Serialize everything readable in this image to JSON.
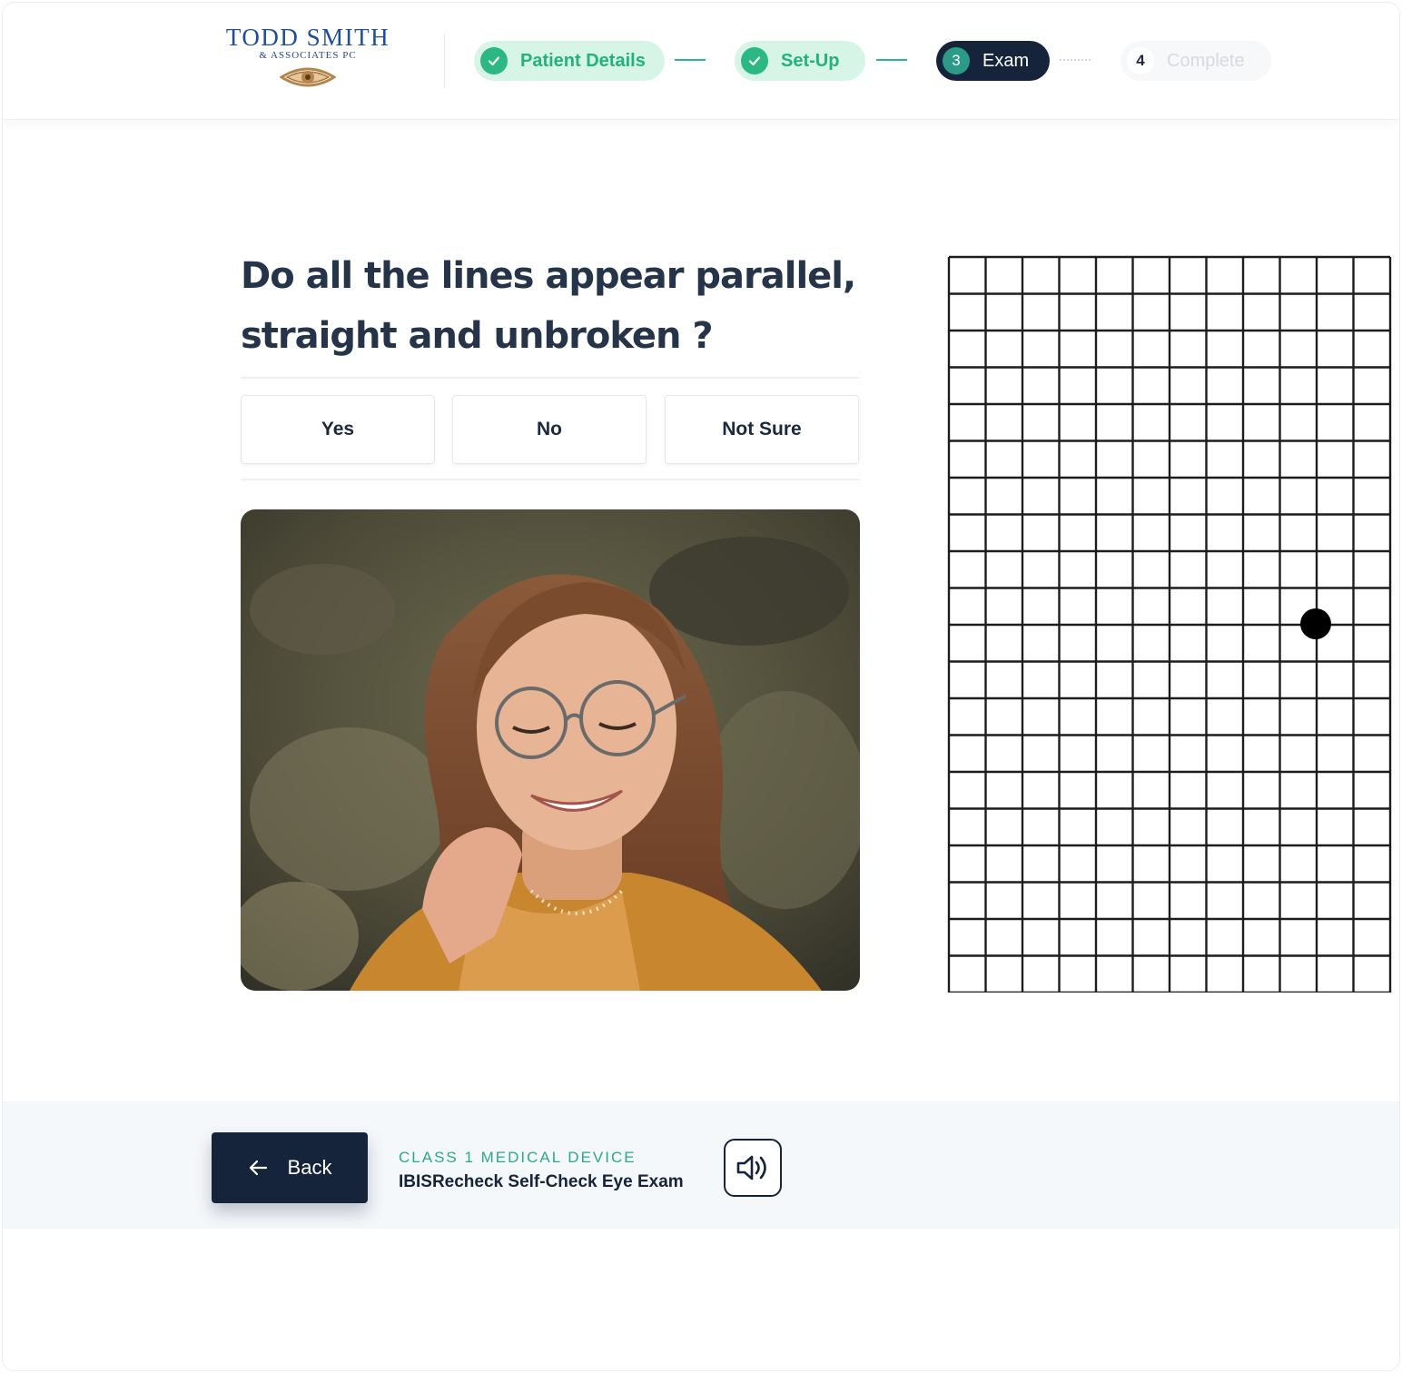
{
  "brand": {
    "name": "TODD SMITH",
    "subtitle": "& ASSOCIATES PC",
    "eye_color": "#b78449"
  },
  "stepper": [
    {
      "number": "",
      "label": "Patient Details",
      "state": "done"
    },
    {
      "number": "",
      "label": "Set-Up",
      "state": "done"
    },
    {
      "number": "3",
      "label": "Exam",
      "state": "active"
    },
    {
      "number": "4",
      "label": "Complete",
      "state": "todo"
    }
  ],
  "question": {
    "line1": "Do all the lines appear parallel,",
    "line2": "straight and unbroken ?"
  },
  "answers": {
    "yes": "Yes",
    "no": "No",
    "not_sure": "Not Sure"
  },
  "photo": {
    "icon": "person-with-glasses-photo"
  },
  "amsler_grid": {
    "columns": 12,
    "rows": 20,
    "line_color": "#1d1d1d"
  },
  "footer": {
    "back_label": "Back",
    "device_class": "CLASS 1 MEDICAL DEVICE",
    "device_name": "IBISRecheck Self-Check Eye Exam",
    "audio_icon": "speaker-icon"
  },
  "colors": {
    "navy": "#15243a",
    "green": "#2bb884",
    "green_light": "#d6f5e6",
    "teal": "#2ba889"
  }
}
